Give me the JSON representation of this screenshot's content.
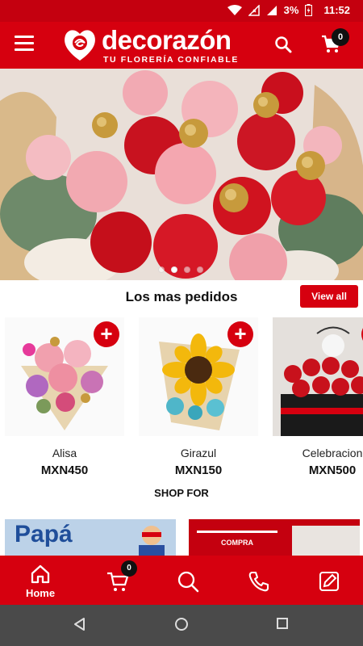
{
  "status_bar": {
    "battery": "3%",
    "time": "11:52"
  },
  "app_bar": {
    "brand_name": "decorazón",
    "brand_tagline": "TU FLORERÍA CONFIABLE",
    "cart_count": "0",
    "icons": {
      "menu": "hamburger-menu-icon",
      "search": "search-icon",
      "cart": "shopping-cart-icon"
    }
  },
  "hero": {
    "slide_count": 4,
    "active_slide": 1
  },
  "featured": {
    "title": "Los mas pedidos",
    "view_all_label": "View all",
    "add_label": "+",
    "products": [
      {
        "name": "Alisa",
        "price": "MXN450"
      },
      {
        "name": "Girazul",
        "price": "MXN150"
      },
      {
        "name": "Celebracion",
        "price": "MXN500"
      }
    ]
  },
  "shop_for": {
    "title": "SHOP FOR",
    "banners": [
      {
        "text": "Papá"
      },
      {
        "text": "COMPRA"
      }
    ]
  },
  "bottom_nav": {
    "home_label": "Home",
    "cart_count": "0",
    "items": [
      "home-icon",
      "cart-icon",
      "search-icon",
      "phone-icon",
      "edit-note-icon"
    ]
  },
  "theme": {
    "primary": "#d6000f",
    "status_bar": "#c4000f",
    "system_nav": "#4a4a4a"
  }
}
